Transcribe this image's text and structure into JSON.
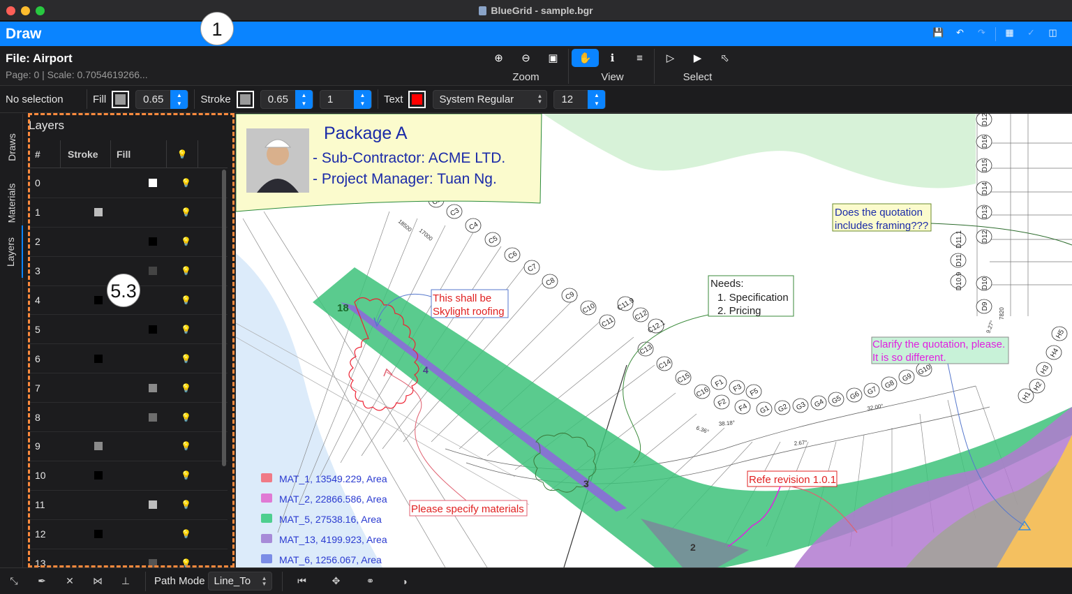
{
  "window": {
    "title": "BlueGrid - sample.bgr"
  },
  "appbar": {
    "title": "Draw",
    "icons": [
      "save-icon",
      "undo-icon",
      "redo-icon",
      "grid-icon",
      "check-icon",
      "share-icon"
    ]
  },
  "callouts": {
    "appbar": "1",
    "panel": "5.3"
  },
  "file": {
    "name": "File: Airport",
    "meta": "Page: 0 | Scale: 0.7054619266..."
  },
  "toolbar": {
    "zoom_label": "Zoom",
    "view_label": "View",
    "select_label": "Select"
  },
  "props": {
    "selection": "No selection",
    "fill_label": "Fill",
    "fill_color": "#9a9a9a",
    "fill_opacity": "0.65",
    "stroke_label": "Stroke",
    "stroke_color": "#9a9a9a",
    "stroke_opacity": "0.65",
    "stroke_width": "1",
    "text_label": "Text",
    "text_color": "#ff0000",
    "font": "System Regular",
    "font_size": "12"
  },
  "sidetabs": [
    "Draws",
    "Materials",
    "Layers"
  ],
  "layers": {
    "title": "Layers",
    "headers": [
      "#",
      "Stroke",
      "Fill",
      "bulb-icon"
    ],
    "rows": [
      {
        "n": "0",
        "stroke": "",
        "fill": "#ffffff"
      },
      {
        "n": "1",
        "stroke": "#bdbdbd",
        "fill": ""
      },
      {
        "n": "2",
        "stroke": "",
        "fill": "#000000"
      },
      {
        "n": "3",
        "stroke": "",
        "fill": "#444444"
      },
      {
        "n": "4",
        "stroke": "#000000",
        "fill": ""
      },
      {
        "n": "5",
        "stroke": "",
        "fill": "#000000"
      },
      {
        "n": "6",
        "stroke": "#000000",
        "fill": ""
      },
      {
        "n": "7",
        "stroke": "",
        "fill": "#8a8a8a"
      },
      {
        "n": "8",
        "stroke": "",
        "fill": "#6e6e6e"
      },
      {
        "n": "9",
        "stroke": "#8a8a8a",
        "fill": ""
      },
      {
        "n": "10",
        "stroke": "#000000",
        "fill": ""
      },
      {
        "n": "11",
        "stroke": "",
        "fill": "#bdbdbd"
      },
      {
        "n": "12",
        "stroke": "#000000",
        "fill": ""
      },
      {
        "n": "13",
        "stroke": "",
        "fill": "#555555"
      }
    ]
  },
  "drawing": {
    "package_title": "Package A",
    "package_line1": "- Sub-Contractor: ACME LTD.",
    "package_line2": "- Project Manager:  Tuan Ng.",
    "note_skylight": [
      "This shall be",
      "Skylight roofing"
    ],
    "note_needs": [
      "Needs:",
      "1. Specification",
      "2. Pricing"
    ],
    "note_framing": [
      "Does the quotation",
      "includes framing???"
    ],
    "note_clarify": [
      "Clarify the quotation, please.",
      "It is so different."
    ],
    "note_materials": "Please specify materials",
    "note_revision": "Refe revision 1.0.1",
    "zone_labels": [
      "18",
      "4",
      "3",
      "2"
    ],
    "legend": [
      {
        "label": "MAT_1, 13549.229, Area",
        "color": "#f07a86"
      },
      {
        "label": "MAT_2, 22866.586, Area",
        "color": "#e07ad4"
      },
      {
        "label": "MAT_5, 27538.16, Area",
        "color": "#4ecf8f"
      },
      {
        "label": "MAT_13, 4199.923, Area",
        "color": "#a78bd8"
      },
      {
        "label": "MAT_6, 1256.067, Area",
        "color": "#7b8de6"
      }
    ],
    "grid_c": [
      "C2",
      "C3",
      "C4",
      "C5",
      "C6",
      "C7",
      "C8",
      "C9",
      "C10",
      "C11",
      "C11.9",
      "C12",
      "C12.1",
      "C13",
      "C14",
      "C15",
      "C16"
    ],
    "grid_fg": [
      "F1",
      "F2",
      "F3",
      "F4",
      "F5",
      "G1",
      "G2",
      "G3",
      "G4",
      "G5",
      "G6",
      "G7",
      "G8",
      "G9",
      "G10"
    ],
    "grid_d": [
      "D12",
      "D16",
      "D15",
      "D14",
      "D13",
      "D12",
      "D11.1",
      "D11",
      "D10.9",
      "D10",
      "D9"
    ],
    "grid_h": [
      "H5",
      "H4",
      "H3",
      "H2",
      "H1"
    ],
    "dims": [
      "18500",
      "17000",
      "6.36°",
      "2.67°",
      "32.00°",
      "38.18°",
      "9.27°",
      "7820"
    ]
  },
  "bottom": {
    "path_mode_label": "Path Mode",
    "path_mode_value": "Line_To",
    "tools": [
      "line-tool-icon",
      "pen-tool-icon",
      "cut-tool-icon",
      "align-tool-icon",
      "anchor-tool-icon",
      "first-point-icon",
      "move-icon",
      "connect-icon",
      "contrast-icon"
    ]
  }
}
